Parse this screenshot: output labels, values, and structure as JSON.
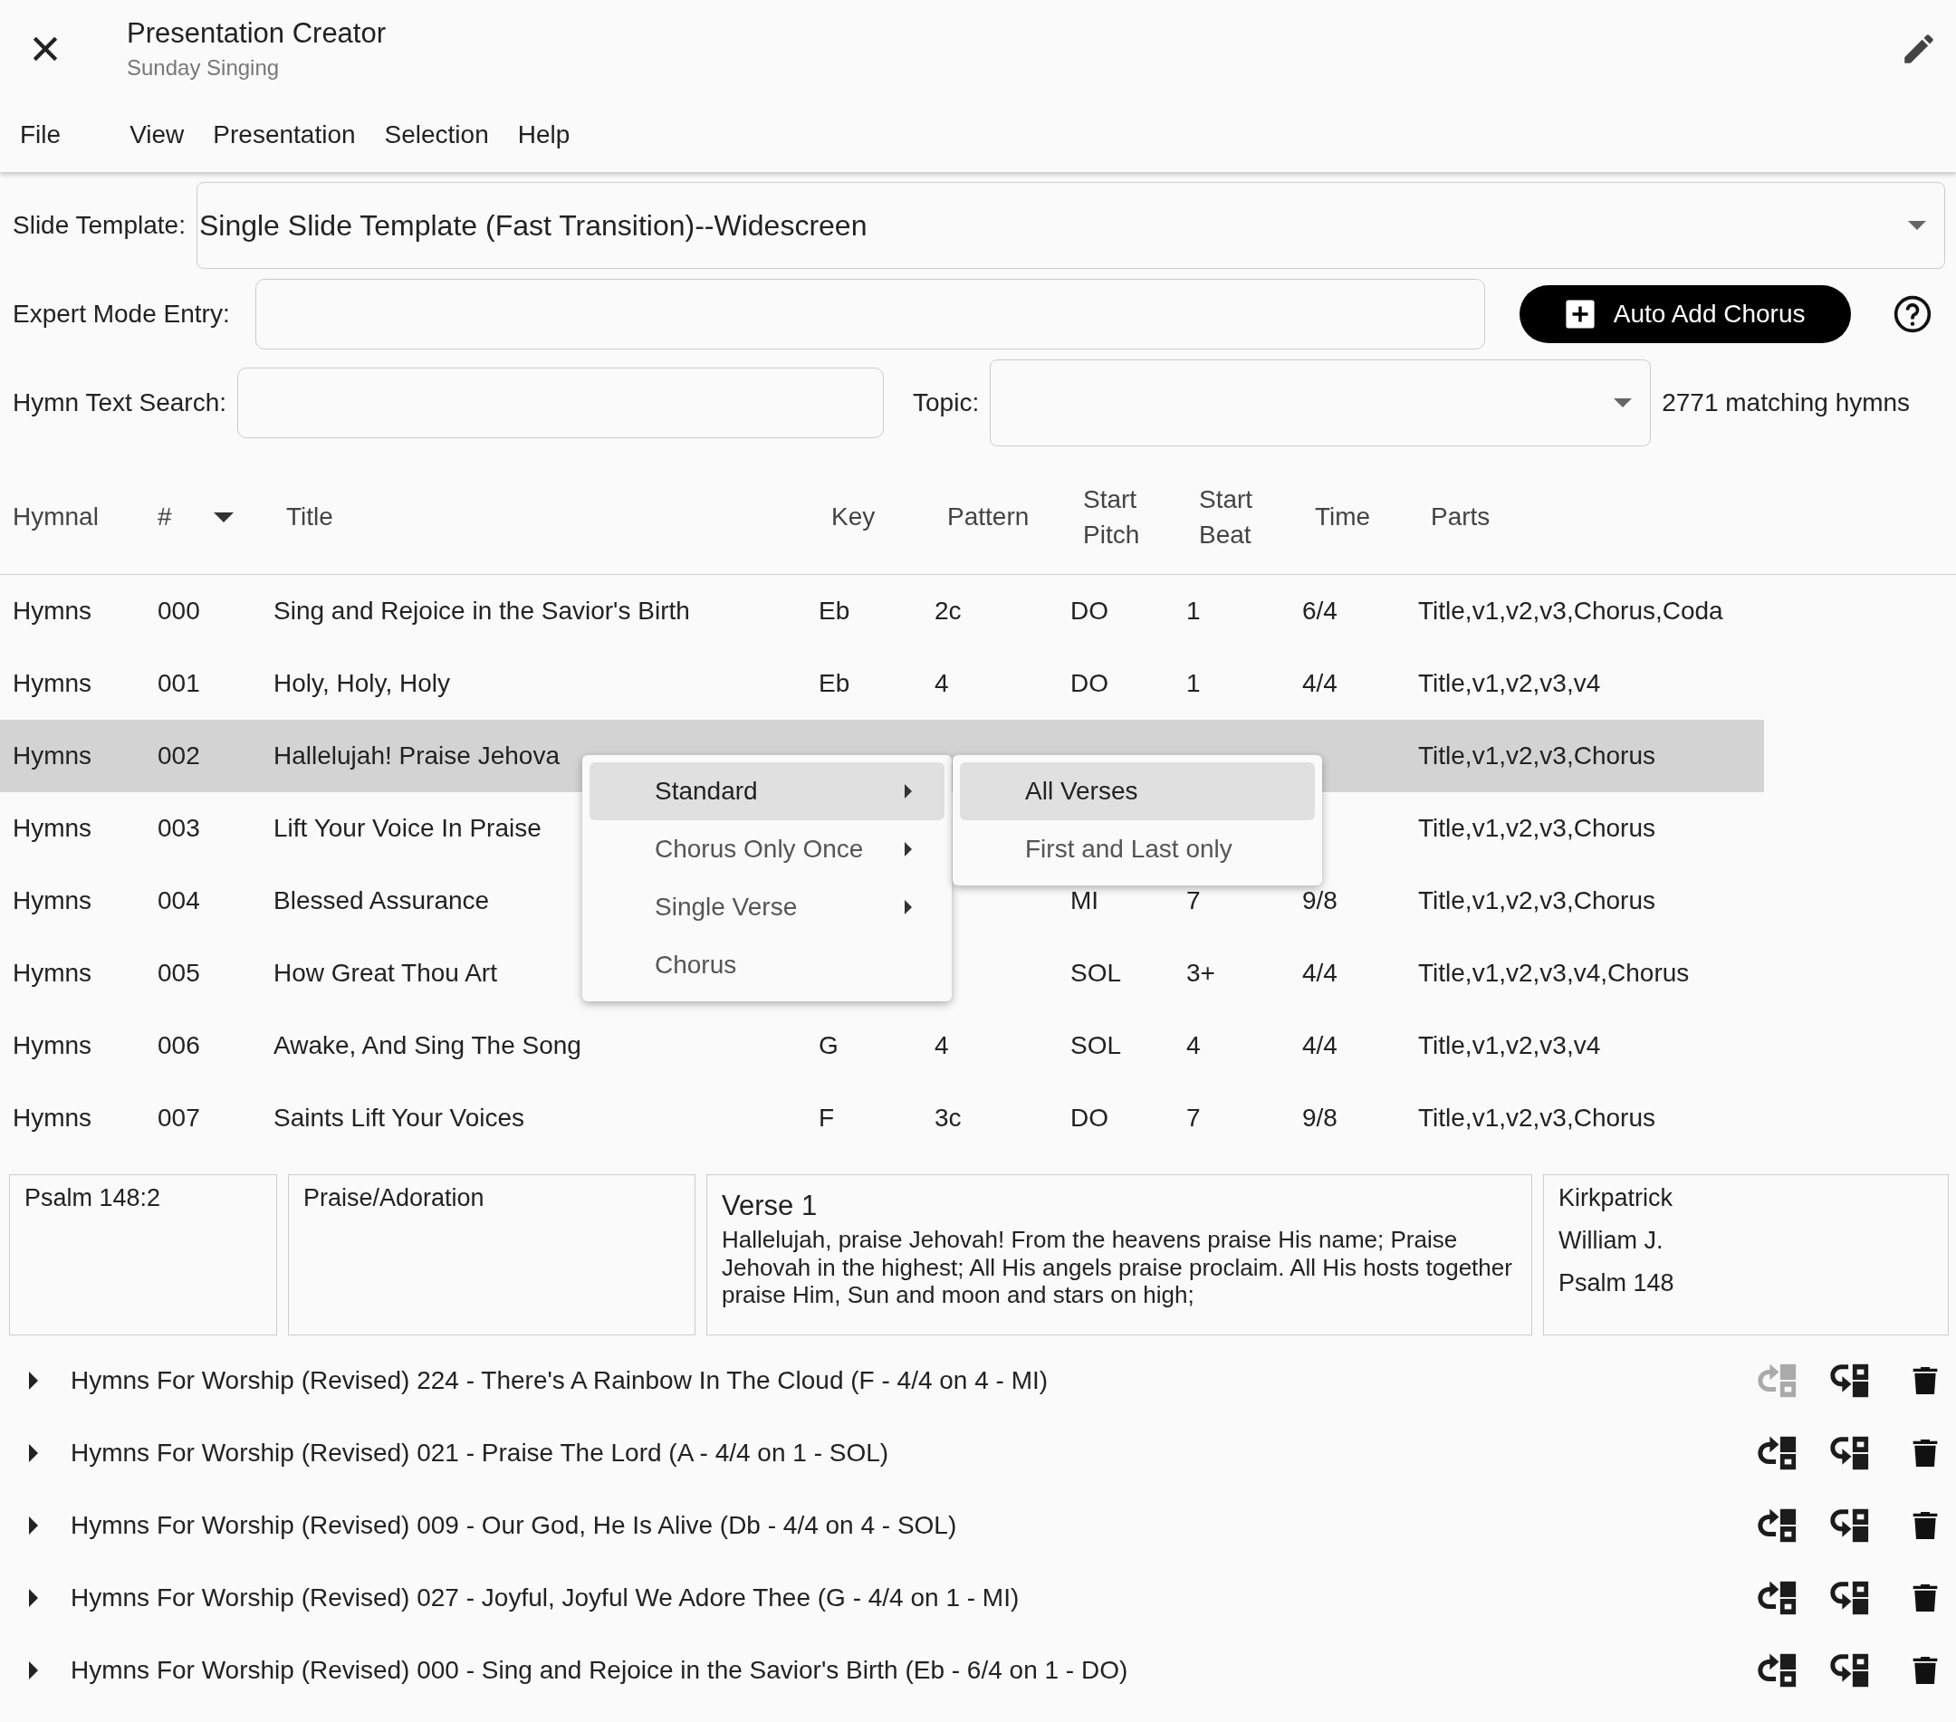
{
  "window": {
    "title": "Presentation Creator",
    "subtitle": "Sunday Singing"
  },
  "menu_bar": [
    "File",
    "View",
    "Presentation",
    "Selection",
    "Help"
  ],
  "slide_template": {
    "label": "Slide Template:",
    "value": "Single Slide Template (Fast Transition)--Widescreen"
  },
  "expert_mode": {
    "label": "Expert Mode Entry:",
    "button": "Auto Add Chorus"
  },
  "search": {
    "label": "Hymn Text Search:",
    "topic_label": "Topic:",
    "count": "2771 matching hymns"
  },
  "table": {
    "columns": [
      "Hymnal",
      "#",
      "Title",
      "Key",
      "Pattern",
      "Start Pitch",
      "Start Beat",
      "Time",
      "Parts"
    ],
    "rows": [
      {
        "hymnal": "Hymns",
        "number": "000",
        "title": "Sing and Rejoice in the Savior's Birth",
        "key": "Eb",
        "pattern": "2c",
        "start_pitch": "DO",
        "start_beat": "1",
        "time": "6/4",
        "parts": "Title,v1,v2,v3,Chorus,Coda",
        "selected": false
      },
      {
        "hymnal": "Hymns",
        "number": "001",
        "title": "Holy, Holy, Holy",
        "key": "Eb",
        "pattern": "4",
        "start_pitch": "DO",
        "start_beat": "1",
        "time": "4/4",
        "parts": "Title,v1,v2,v3,v4",
        "selected": false
      },
      {
        "hymnal": "Hymns",
        "number": "002",
        "title": "Hallelujah! Praise Jehova",
        "parts": "Title,v1,v2,v3,Chorus",
        "selected": true
      },
      {
        "hymnal": "Hymns",
        "number": "003",
        "title": "Lift Your Voice In Praise",
        "parts": "Title,v1,v2,v3,Chorus",
        "selected": false
      },
      {
        "hymnal": "Hymns",
        "number": "004",
        "title": "Blessed Assurance",
        "start_pitch": "MI",
        "start_beat": "7",
        "time": "9/8",
        "parts": "Title,v1,v2,v3,Chorus",
        "selected": false
      },
      {
        "hymnal": "Hymns",
        "number": "005",
        "title": "How Great Thou Art",
        "start_pitch": "SOL",
        "start_beat": "3+",
        "time": "4/4",
        "parts": "Title,v1,v2,v3,v4,Chorus",
        "selected": false
      },
      {
        "hymnal": "Hymns",
        "number": "006",
        "title": "Awake, And Sing The Song",
        "key": "G",
        "pattern": "4",
        "start_pitch": "SOL",
        "start_beat": "4",
        "time": "4/4",
        "parts": "Title,v1,v2,v3,v4",
        "selected": false
      },
      {
        "hymnal": "Hymns",
        "number": "007",
        "title": "Saints Lift Your Voices",
        "key": "F",
        "pattern": "3c",
        "start_pitch": "DO",
        "start_beat": "7",
        "time": "9/8",
        "parts": "Title,v1,v2,v3,Chorus",
        "selected": false
      }
    ]
  },
  "context_menu": {
    "items": [
      {
        "label": "Standard",
        "submenu": true,
        "selected": true
      },
      {
        "label": "Chorus Only Once",
        "submenu": true,
        "selected": false
      },
      {
        "label": "Single Verse",
        "submenu": true,
        "selected": false
      },
      {
        "label": "Chorus",
        "submenu": false,
        "selected": false
      }
    ],
    "submenu": [
      {
        "label": "All Verses",
        "selected": true
      },
      {
        "label": "First and Last only",
        "selected": false
      }
    ]
  },
  "details": {
    "scripture": "Psalm 148:2",
    "topic": "Praise/Adoration",
    "verse_title": "Verse 1",
    "verse_text": "Hallelujah, praise Jehovah! From the heavens praise His name; Praise Jehovah in the highest; All His angels praise proclaim. All His hosts together praise Him, Sun and moon and stars on high;",
    "credits": [
      "Kirkpatrick",
      "William J.",
      "Psalm 148"
    ]
  },
  "presentation": [
    {
      "label": "Hymns For Worship (Revised) 224 - There's A Rainbow In The Cloud (F - 4/4 on 4 - MI)",
      "move_up_disabled": true
    },
    {
      "label": "Hymns For Worship (Revised) 021 - Praise The Lord (A - 4/4 on 1 - SOL)",
      "move_up_disabled": false
    },
    {
      "label": "Hymns For Worship (Revised) 009 - Our God, He Is Alive (Db - 4/4 on 4 - SOL)",
      "move_up_disabled": false
    },
    {
      "label": "Hymns For Worship (Revised) 027 - Joyful, Joyful We Adore Thee (G - 4/4 on 1 - MI)",
      "move_up_disabled": false
    },
    {
      "label": "Hymns For Worship (Revised) 000 - Sing and Rejoice in the Savior's Birth (Eb - 6/4 on 1 - DO)",
      "move_up_disabled": false
    }
  ]
}
